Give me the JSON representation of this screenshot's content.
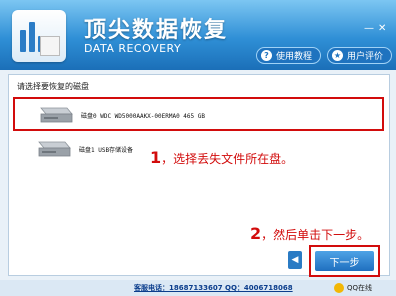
{
  "header": {
    "title": "顶尖数据恢复",
    "subtitle": "DATA RECOVERY",
    "minimize": "—",
    "close": "✕",
    "guide_button": "使用教程",
    "review_button": "用户评价"
  },
  "panel": {
    "prompt": "请选择要恢复的磁盘",
    "disks": [
      {
        "label": "磁盘0  WDC WD5000AAKX-00ERMA0   465 GB"
      },
      {
        "label": "磁盘1  USB存储设备"
      }
    ]
  },
  "annotations": {
    "step1_num": "1",
    "step1_text": "，选择丢失文件所在盘。",
    "step2_num": "2",
    "step2_text": "，然后单击下一步。"
  },
  "buttons": {
    "back": "◀",
    "next": "下一步"
  },
  "footer": {
    "service": "客服电话：18687133607  QQ：4006718068",
    "qq": "QQ在线"
  }
}
